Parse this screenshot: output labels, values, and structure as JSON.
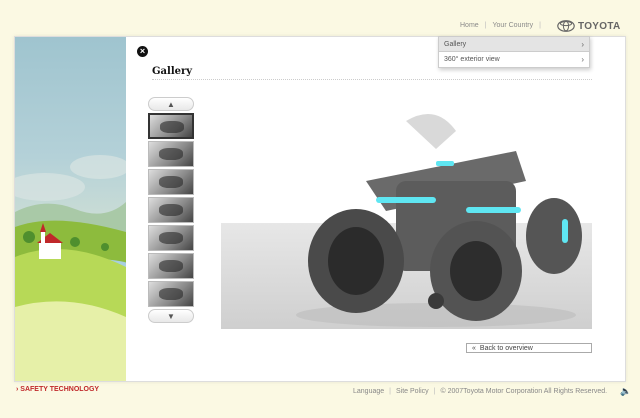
{
  "topnav": {
    "home": "Home",
    "your_country": "Your Country",
    "brand": "TOYOTA"
  },
  "page": {
    "title": "Gallery",
    "close_glyph": "×"
  },
  "dropdown": {
    "items": [
      {
        "label": "Gallery",
        "active": true
      },
      {
        "label": "360° exterior view",
        "active": false
      }
    ],
    "chevron": "›"
  },
  "thumbnails": {
    "up_glyph": "▲",
    "down_glyph": "▼",
    "count": 7,
    "selected_index": 0
  },
  "back_link": {
    "arrow": "«",
    "label": "Back to overview"
  },
  "footer": {
    "section": "› SAFETY TECHNOLOGY",
    "language": "Language",
    "site_policy": "Site Policy",
    "copyright": "© 2007Toyota Motor Corporation All Rights Reserved.",
    "speaker_glyph": "🔈"
  },
  "colors": {
    "accent_red": "#c0282a",
    "background": "#fbf9e3",
    "vehicle_glow": "#5fe6f2"
  }
}
